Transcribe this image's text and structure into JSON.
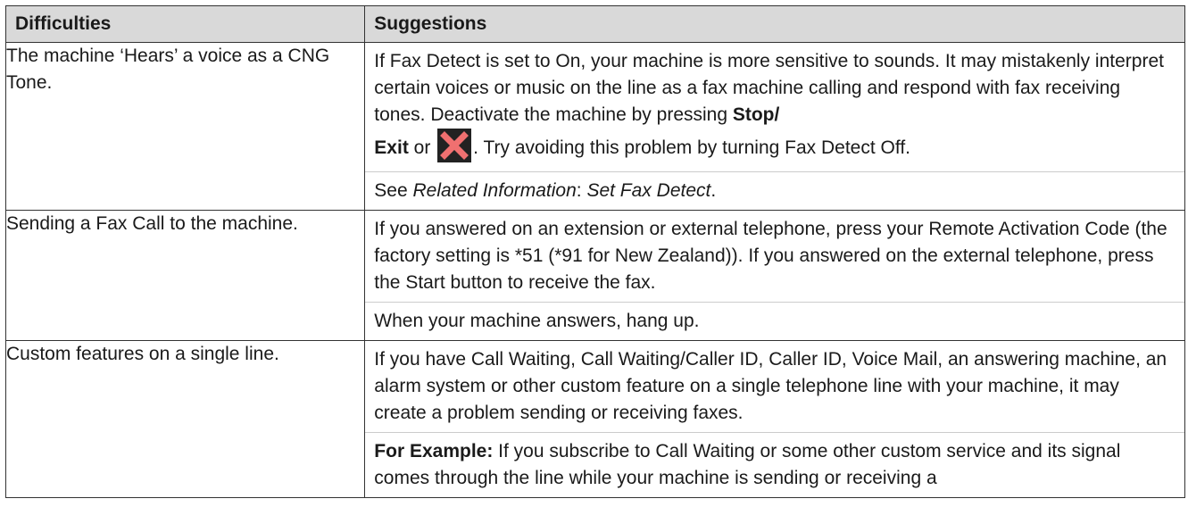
{
  "table": {
    "headers": [
      "Difficulties",
      "Suggestions"
    ],
    "rows": [
      {
        "difficulty": "The machine ‘Hears’ a voice as a CNG Tone.",
        "p1": "If Fax Detect is set to On, your machine is more sensitive to sounds. It may mistakenly interpret certain voices or music on the line as a fax machine calling and respond with fax receiving tones. Deactivate the machine by pressing ",
        "p1_bold1": "Stop/",
        "p2_bold": "Exit",
        "p2_or": " or ",
        "p2_rest": ". Try avoiding this problem by turning Fax Detect Off.",
        "p3_pre": "See ",
        "p3_ital1": "Related Information",
        "p3_mid": ": ",
        "p3_ital2": "Set Fax Detect",
        "p3_end": "."
      },
      {
        "difficulty": "Sending a Fax Call to the machine.",
        "p1": "If you answered on an extension or external telephone, press your Remote Activation Code (the factory setting is *51 (*91 for New Zealand)). If you answered on the external telephone, press the Start button to receive the fax.",
        "p2": "When your machine answers, hang up."
      },
      {
        "difficulty": "Custom features on a single line.",
        "p1": "If you have Call Waiting, Call Waiting/Caller ID, Caller ID, Voice Mail, an answering machine, an alarm system or other custom feature on a single telephone line with your machine, it may create a problem sending or receiving faxes.",
        "p2_bold": "For Example:",
        "p2_rest": " If you subscribe to Call Waiting or some other custom service and its signal comes through the line while your machine is sending or receiving a"
      }
    ]
  },
  "icons": {
    "stop": "stop-x-icon",
    "stop_color": "#f07070"
  }
}
